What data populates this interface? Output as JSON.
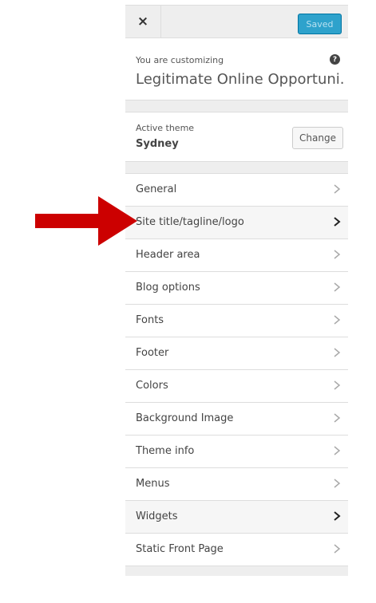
{
  "header": {
    "close_label": "×",
    "saved_label": "Saved"
  },
  "info": {
    "customizing_label": "You are customizing",
    "site_title": "Legitimate Online Opportuni...",
    "help_label": "?"
  },
  "theme": {
    "label": "Active theme",
    "name": "Sydney",
    "change_label": "Change"
  },
  "menu": {
    "items": [
      {
        "label": "General"
      },
      {
        "label": "Site title/tagline/logo"
      },
      {
        "label": "Header area"
      },
      {
        "label": "Blog options"
      },
      {
        "label": "Fonts"
      },
      {
        "label": "Footer"
      },
      {
        "label": "Colors"
      },
      {
        "label": "Background Image"
      },
      {
        "label": "Theme info"
      },
      {
        "label": "Menus"
      },
      {
        "label": "Widgets"
      },
      {
        "label": "Static Front Page"
      }
    ]
  },
  "colors": {
    "accent": "#2ea2cc",
    "arrow": "#cc0000"
  },
  "icons": {
    "close": "close-icon",
    "help": "help-icon",
    "chevron": "chevron-right-icon",
    "arrow": "red-arrow-annotation"
  }
}
